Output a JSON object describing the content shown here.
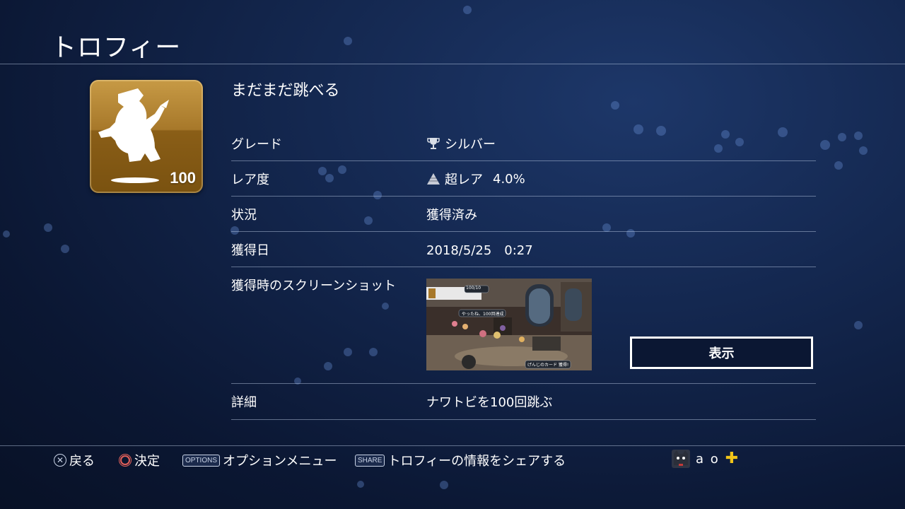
{
  "header": {
    "title": "トロフィー"
  },
  "trophy": {
    "icon_count": "100",
    "name": "まだまだ跳べる",
    "rows": {
      "grade": {
        "label": "グレード",
        "value": "シルバー",
        "icon": "silver-trophy-icon"
      },
      "rarity": {
        "label": "レア度",
        "value": "超レア",
        "percent": "4.0%",
        "icon": "rarity-pyramid-icon"
      },
      "status": {
        "label": "状況",
        "value": "獲得済み"
      },
      "date": {
        "label": "獲得日",
        "value": "2018/5/25　0:27"
      },
      "screenshot": {
        "label": "獲得時のスクリーンショット",
        "button_label": "表示"
      },
      "detail": {
        "label": "詳細",
        "value": "ナワトビを100回跳ぶ"
      }
    }
  },
  "screenshot_overlay": {
    "count_badge": "100/10",
    "message": "やったね、100回達成",
    "item_banner": "げんじのカード 獲得!"
  },
  "footer": {
    "back": {
      "glyph": "✕",
      "label": "戻る"
    },
    "confirm": {
      "label": "決定"
    },
    "options": {
      "pill": "OPTIONS",
      "label": "オプションメニュー"
    },
    "share": {
      "pill": "SHARE",
      "label": "トロフィーの情報をシェアする"
    },
    "user": {
      "name": "a o",
      "plus_badge": "✚"
    }
  },
  "colors": {
    "accent_gold": "#a7782a",
    "plus_yellow": "#f0c419",
    "circle_red": "#e4605a"
  }
}
